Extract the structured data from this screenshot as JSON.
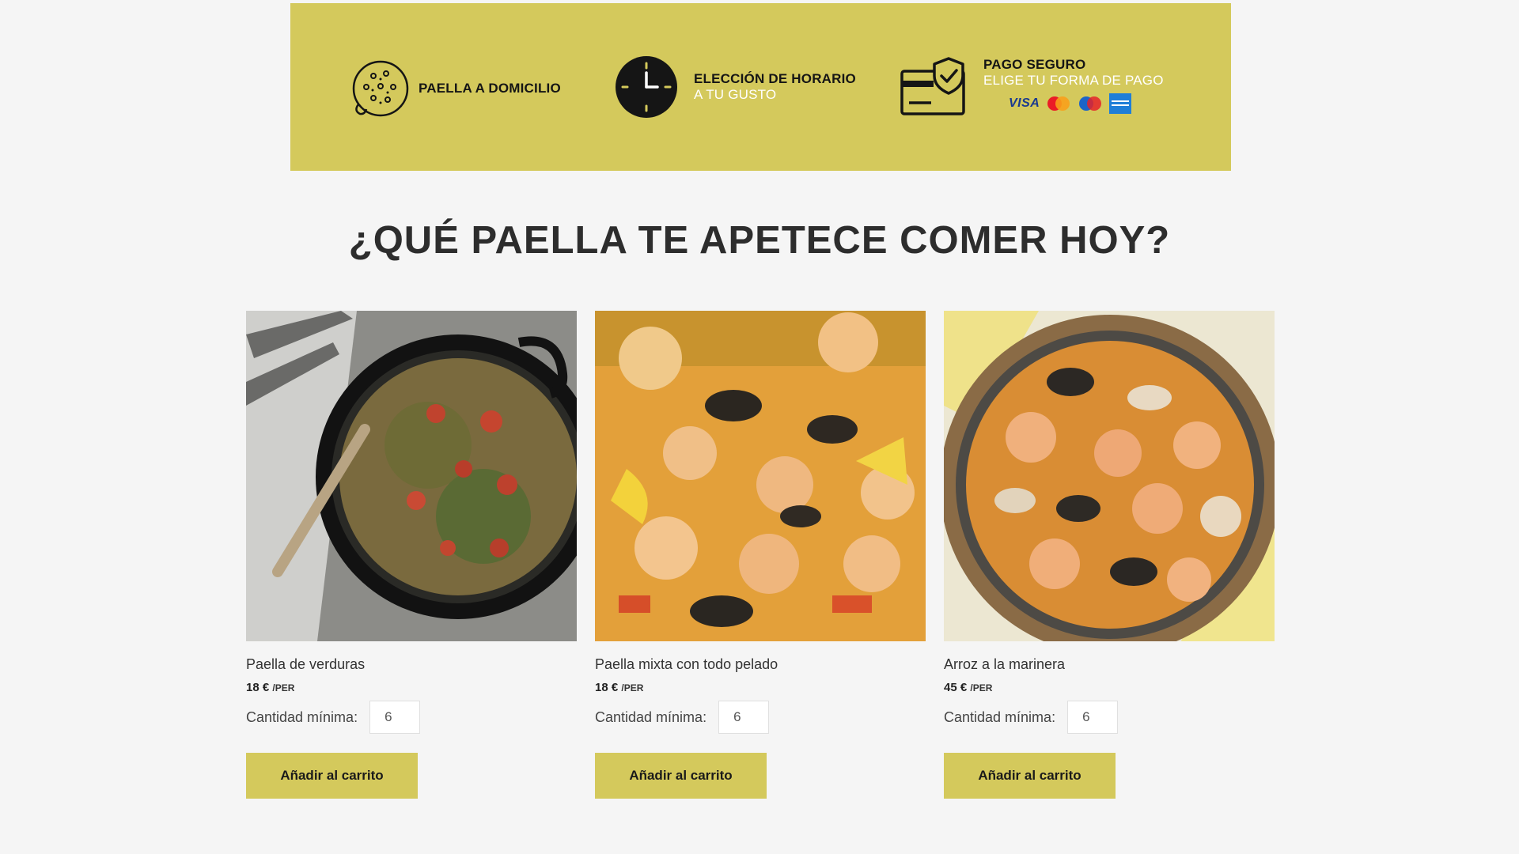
{
  "banner": {
    "features": [
      {
        "title": "PAELLA A DOMICILIO",
        "icon": "paella-pan-icon"
      },
      {
        "title": "ELECCIÓN DE HORARIO",
        "subtitle": "A TU GUSTO",
        "icon": "clock-icon"
      },
      {
        "title": "PAGO SEGURO",
        "subtitle": "ELIGE TU FORMA DE PAGO",
        "icon": "secure-payment-icon"
      }
    ],
    "payment_cards": {
      "visa": "VISA",
      "icons": [
        "visa-icon",
        "mastercard-icon",
        "maestro-icon",
        "amex-icon"
      ]
    },
    "color": "#d4c95c"
  },
  "heading": "¿QUÉ PAELLA TE APETECE COMER HOY?",
  "products": [
    {
      "name": "Paella de verduras",
      "price": "18 €",
      "unit": "/PER",
      "qty_label": "Cantidad mínima:",
      "qty_value": "6",
      "button": "Añadir al carrito"
    },
    {
      "name": "Paella mixta con todo pelado",
      "price": "18 €",
      "unit": "/PER",
      "qty_label": "Cantidad mínima:",
      "qty_value": "6",
      "button": "Añadir al carrito"
    },
    {
      "name": "Arroz a la marinera",
      "price": "45 €",
      "unit": "/PER",
      "qty_label": "Cantidad mínima:",
      "qty_value": "6",
      "button": "Añadir al carrito"
    }
  ]
}
